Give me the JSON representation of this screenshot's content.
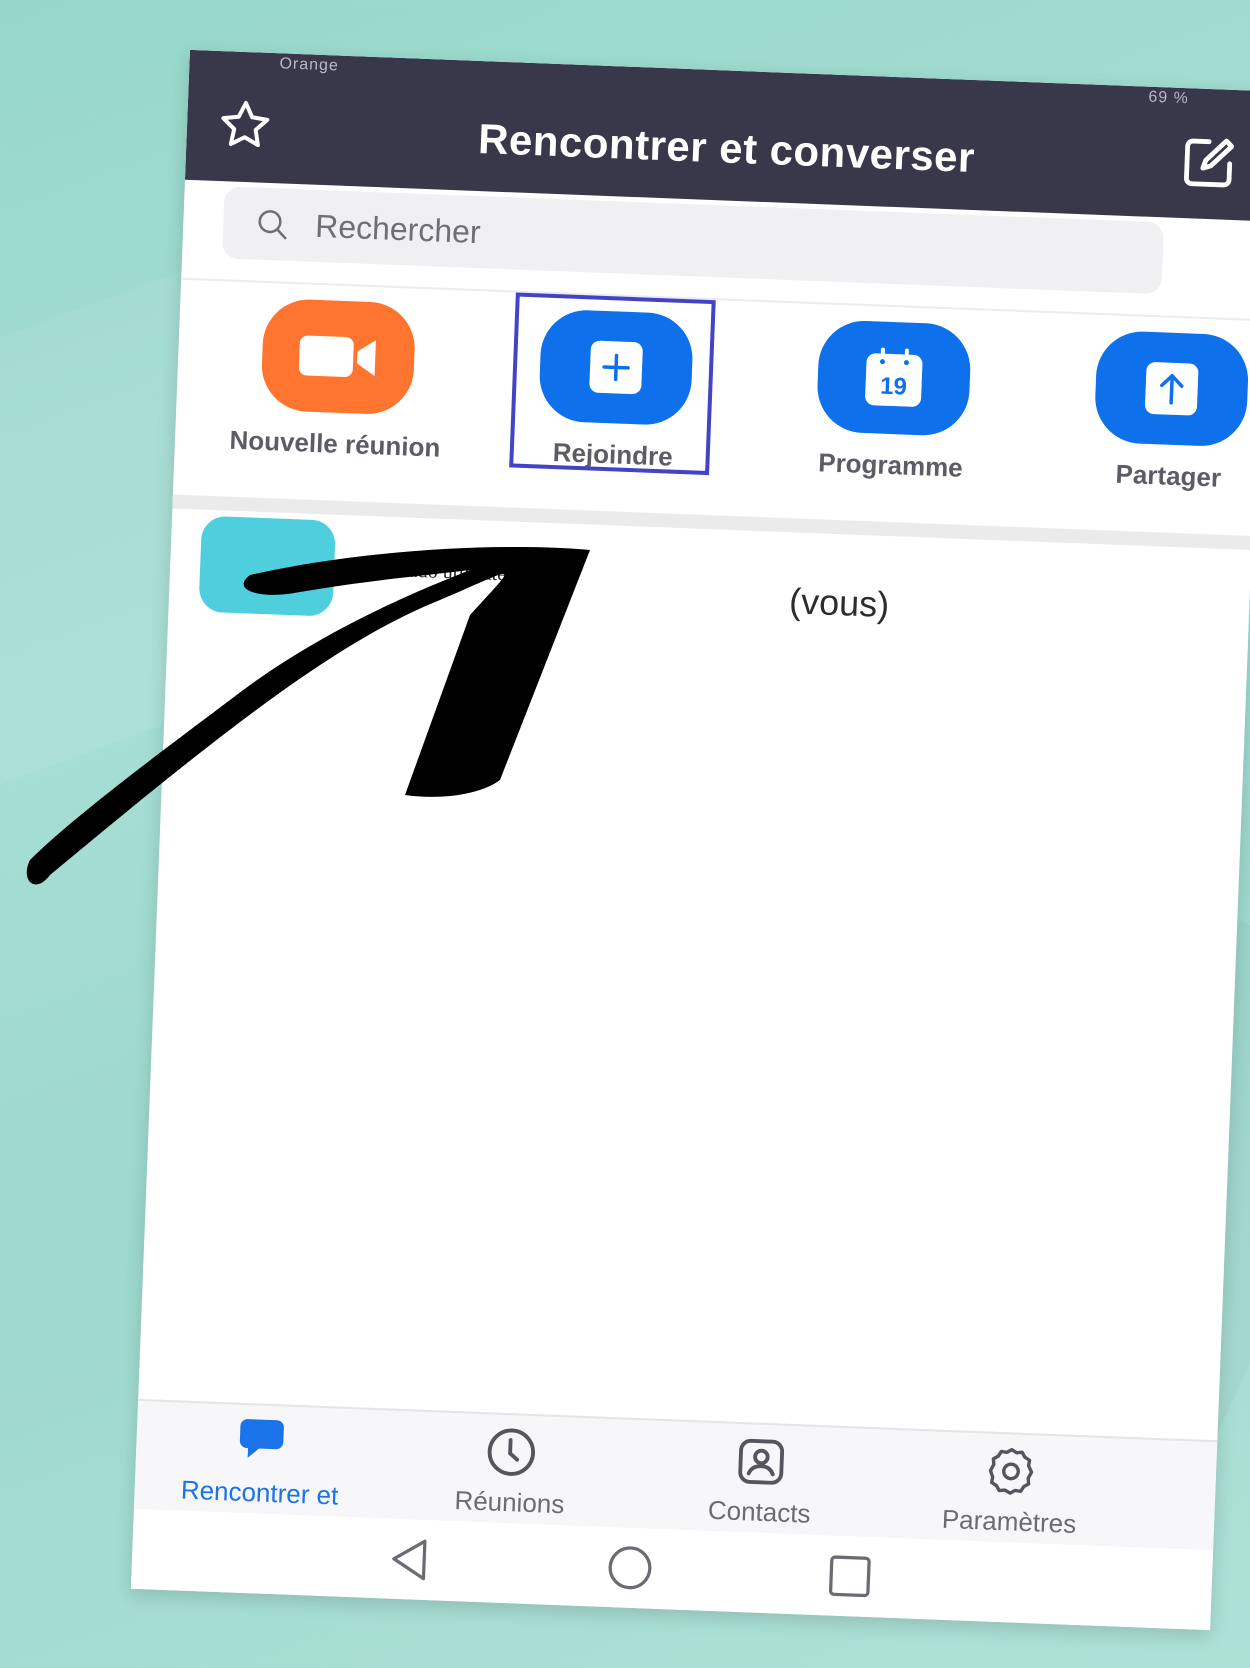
{
  "status_bar": {
    "left": "Orange",
    "right": "69 %"
  },
  "header": {
    "title": "Rencontrer et converser"
  },
  "search": {
    "placeholder": "Rechercher"
  },
  "actions": [
    {
      "label": "Nouvelle réunion",
      "icon": "video-camera-icon",
      "color": "#ff742e"
    },
    {
      "label": "Rejoindre",
      "icon": "plus-icon",
      "color": "#0e71eb"
    },
    {
      "label": "Programme",
      "icon": "calendar-icon",
      "color": "#0e71eb",
      "calendar_day": "19"
    },
    {
      "label": "Partager",
      "icon": "share-upload-icon",
      "color": "#0e71eb"
    }
  ],
  "contact": {
    "name": "Pseudo utilisateur",
    "suffix": "(vous)"
  },
  "bottom_nav": [
    {
      "label": "Rencontrer et",
      "icon": "chat-bubble-icon",
      "active": true
    },
    {
      "label": "Réunions",
      "icon": "clock-icon",
      "active": false
    },
    {
      "label": "Contacts",
      "icon": "contact-card-icon",
      "active": false
    },
    {
      "label": "Paramètres",
      "icon": "gear-icon",
      "active": false
    }
  ],
  "colors": {
    "header_bg": "#39374a",
    "accent_blue": "#0e71eb",
    "accent_orange": "#ff742e",
    "highlight_border": "#4343c7",
    "background": "#9dd9cd"
  }
}
